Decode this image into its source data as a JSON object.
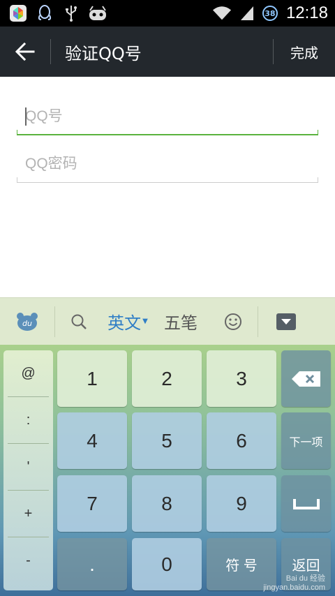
{
  "status_bar": {
    "time": "12:18",
    "battery": "38",
    "icons": [
      "app-store-icon",
      "qq-penguin-icon",
      "usb-icon",
      "android-debug-icon",
      "wifi-icon",
      "signal-icon",
      "battery-icon"
    ]
  },
  "app_bar": {
    "back_icon": "arrow-left-icon",
    "title": "验证QQ号",
    "done_label": "完成"
  },
  "form": {
    "qq_number": {
      "value": "",
      "placeholder": "QQ号"
    },
    "qq_password": {
      "value": "",
      "placeholder": "QQ密码"
    }
  },
  "keyboard": {
    "toolbar": {
      "logo_icon": "du-bear-icon",
      "search_icon": "search-icon",
      "english_label": "英文",
      "wubi_label": "五笔",
      "emoji_icon": "smiley-icon",
      "hide_icon": "keyboard-hide-icon"
    },
    "symbols": [
      "@",
      ":",
      "'",
      "+",
      "-"
    ],
    "digits": [
      "1",
      "2",
      "3",
      "4",
      "5",
      "6",
      "7",
      "8",
      "9"
    ],
    "zero": "0",
    "dot": ".",
    "symbol_label": "符 号",
    "return_label": "返回",
    "next_label": "下一项",
    "delete_icon": "backspace-icon",
    "space_icon": "space-icon"
  },
  "watermark": {
    "text": "Bai du 经验",
    "url": "jingyan.baidu.com"
  },
  "colors": {
    "app_bar": "#23282d",
    "focus_line": "#5ab33e",
    "active_tab": "#2f7ec6"
  }
}
